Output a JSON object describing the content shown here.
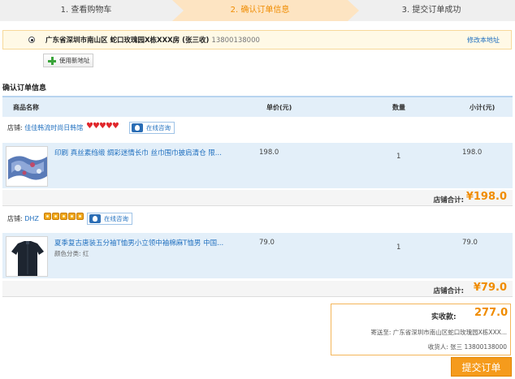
{
  "steps": [
    {
      "label": "1. 查看购物车"
    },
    {
      "label": "2. 确认订单信息"
    },
    {
      "label": "3. 提交订单成功"
    }
  ],
  "address": {
    "text": "广东省深圳市南山区 蛇口玫瑰园X栋XXX房 (张三收)",
    "phone": "13800138000",
    "edit_label": "修改本地址",
    "new_address_label": "使用新地址"
  },
  "section_title": "确认订单信息",
  "table_headers": {
    "name": "商品名称",
    "price": "单价(元)",
    "qty": "数量",
    "subtotal": "小计(元)"
  },
  "shops": [
    {
      "label": "店铺:",
      "name": "佳佳韩流时尚日韩馆",
      "rating_icon": "heart-icon",
      "chat_label": "在线咨询",
      "item": {
        "name": "印刷 真丝素绉缎 绸彩迷情长巾 丝巾围巾披肩清仓 限...",
        "spec": "",
        "price": "198.0",
        "qty": "1",
        "subtotal": "198.0"
      },
      "total_label": "店铺合计:",
      "total": "¥198.0"
    },
    {
      "label": "店铺:",
      "name": "DHZ",
      "rating_icon": "crown-icon",
      "chat_label": "在线咨询",
      "item": {
        "name": "夏季复古唐装五分袖T恤男小立领中袖棉麻T恤男 中国...",
        "spec": "颜色分类: 红",
        "price": "79.0",
        "qty": "1",
        "subtotal": "79.0"
      },
      "total_label": "店铺合计:",
      "total": "¥79.0"
    }
  ],
  "summary": {
    "pay_label": "实收款:",
    "pay_value": "277.0",
    "ship_label": "寄送至:",
    "ship_address": "广东省深圳市南山区蛇口玫瑰园X栋XXX...",
    "receiver_label": "收货人:",
    "receiver": "张三 13800138000"
  },
  "submit_label": "提交订单",
  "colors": {
    "accent": "#f08c00",
    "link": "#1f6fbf",
    "table_bg": "#e3eff9"
  }
}
